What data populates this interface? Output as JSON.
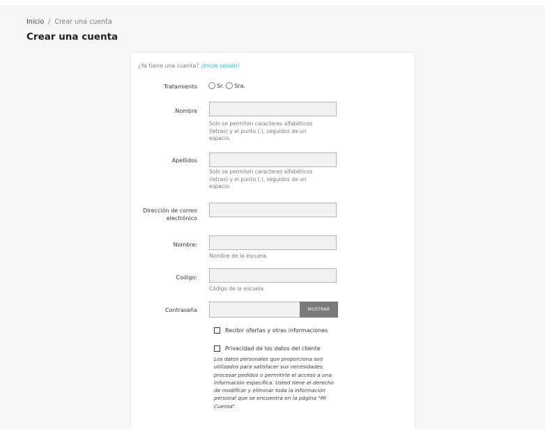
{
  "breadcrumb": {
    "home": "Inicio",
    "separator": "/",
    "current": "Crear una cuenta"
  },
  "page_title": "Crear una cuenta",
  "form": {
    "already_text": "¿Ya tiene una cuenta?",
    "login_link": "¡Inicie sesión!",
    "salutation": {
      "label": "Tratamiento",
      "options": [
        "Sr.",
        "Sra."
      ]
    },
    "first_name": {
      "label": "Nombre",
      "help": "Solo se permiten caracteres alfabéticos (letras) y el punto (.), seguidos de un espacio."
    },
    "last_name": {
      "label": "Apellidos",
      "help": "Solo se permiten caracteres alfabéticos (letras) y el punto (.), seguidos de un espacio."
    },
    "email": {
      "label": "Dirección de correo electrónico"
    },
    "school_name": {
      "label": "Nombre:",
      "help": "Nombre de la escuela."
    },
    "school_code": {
      "label": "Codigo:",
      "help": "Código de la escuela."
    },
    "password": {
      "label": "Contraseña",
      "show_button": "MOSTRAR"
    },
    "offers_checkbox": "Recibir ofertas y otras informaciones",
    "privacy_checkbox": "Privacidad de los datos del cliente",
    "privacy_text": "Los datos personales que proporciona son utilizados para satisfacer sus necesidades, procesar pedidos o permitirle el acceso a una información específica. Usted tiene el derecho de modificar y eliminar toda la información personal que se encuentra en la página \"Mi Cuenta\"."
  },
  "colors": {
    "link": "#24b9d7",
    "button": "#7a7a7a",
    "input_bg": "#f1f1f1",
    "page_bg": "#f6f6f6"
  }
}
